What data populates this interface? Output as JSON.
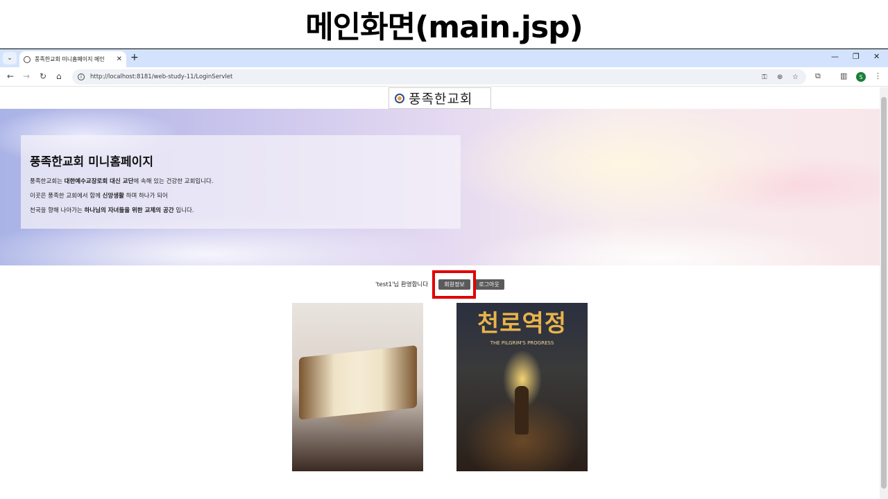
{
  "slide": {
    "title": "메인화면(main.jsp)"
  },
  "browser": {
    "tab_title": "풍족한교회 미니홈페이지 메인",
    "url": "http://localhost:8181/web-study-11/LoginServlet",
    "profile_initial": "S",
    "new_tab_symbol": "+",
    "icons": [
      "tab-menu-icon",
      "globe-icon",
      "close-icon",
      "back-icon",
      "forward-icon",
      "reload-icon",
      "home-icon",
      "info-icon",
      "password-key-icon",
      "zoom-icon",
      "bookmark-star-icon",
      "extensions-icon",
      "side-panel-icon",
      "more-icon",
      "minimize-icon",
      "restore-icon",
      "window-close-icon"
    ]
  },
  "page": {
    "logo_text": "풍족한교회",
    "hero": {
      "title": "풍족한교회 미니홈페이지",
      "line1_a": "풍족한교회는 ",
      "line1_b": "대한예수교장로회 대신 교단",
      "line1_c": "에 속해 있는 건강한 교회입니다.",
      "line2_a": "이곳은 풍족한 교회에서 함께 ",
      "line2_b": "신앙생활",
      "line2_c": " 하며 하나가 되어",
      "line3_a": "천국을 향해 나아가는 ",
      "line3_b": "하나님의 자녀들을 위한 교제의 공간",
      "line3_c": " 입니다."
    },
    "welcome": "'test1'님 환영합니다",
    "member_info_button": "회원정보",
    "logout_button": "로그아웃",
    "images": {
      "right_title": "천로역정",
      "right_subtitle": "THE PILGRIM'S PROGRESS"
    }
  },
  "colors": {
    "highlight": "#e00000",
    "tabbar": "#d3e3fd",
    "button": "#5a5a5a"
  }
}
